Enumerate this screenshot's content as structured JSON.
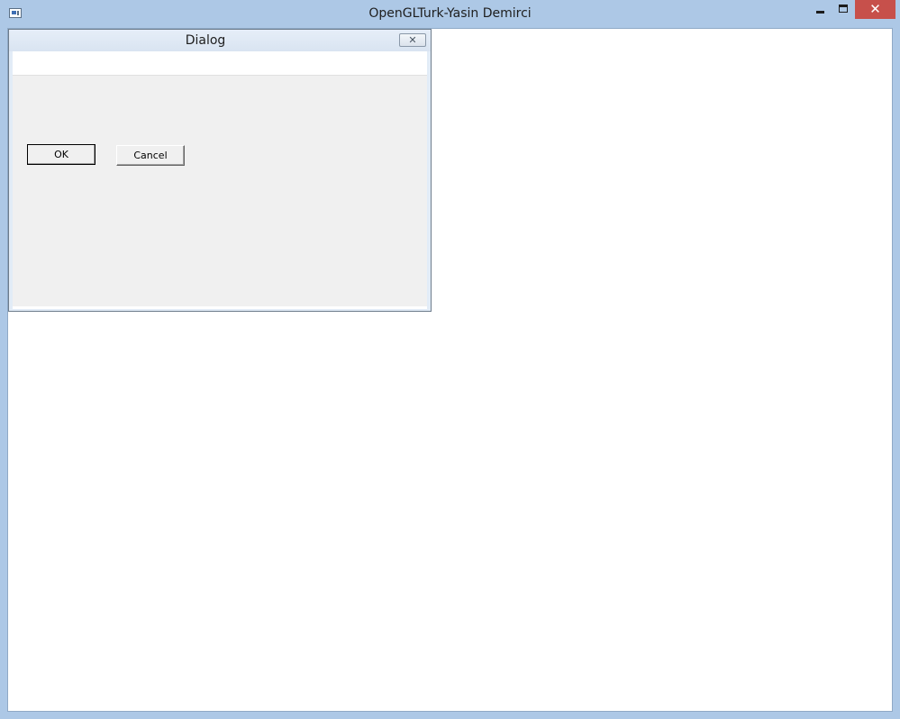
{
  "main_window": {
    "title": "OpenGLTurk-Yasin Demirci",
    "close_glyph": "✕"
  },
  "dialog": {
    "title": "Dialog",
    "close_glyph": "✕",
    "ok_label": "OK",
    "cancel_label": "Cancel"
  },
  "colors": {
    "frame": "#adc8e6",
    "close_button": "#c7504b",
    "dialog_body": "#f0f0f0"
  }
}
